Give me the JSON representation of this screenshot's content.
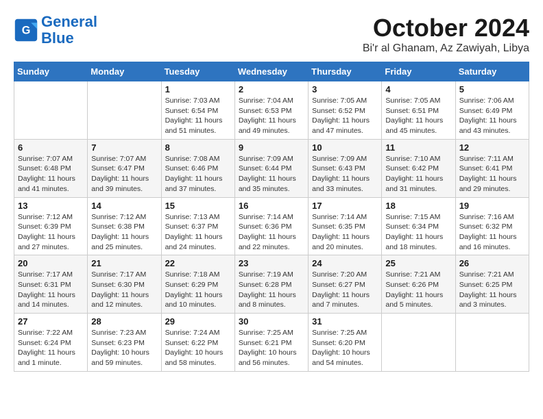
{
  "logo": {
    "line1": "General",
    "line2": "Blue"
  },
  "title": "October 2024",
  "location": "Bi'r al Ghanam, Az Zawiyah, Libya",
  "days_of_week": [
    "Sunday",
    "Monday",
    "Tuesday",
    "Wednesday",
    "Thursday",
    "Friday",
    "Saturday"
  ],
  "weeks": [
    [
      {
        "day": "",
        "detail": ""
      },
      {
        "day": "",
        "detail": ""
      },
      {
        "day": "1",
        "detail": "Sunrise: 7:03 AM\nSunset: 6:54 PM\nDaylight: 11 hours and 51 minutes."
      },
      {
        "day": "2",
        "detail": "Sunrise: 7:04 AM\nSunset: 6:53 PM\nDaylight: 11 hours and 49 minutes."
      },
      {
        "day": "3",
        "detail": "Sunrise: 7:05 AM\nSunset: 6:52 PM\nDaylight: 11 hours and 47 minutes."
      },
      {
        "day": "4",
        "detail": "Sunrise: 7:05 AM\nSunset: 6:51 PM\nDaylight: 11 hours and 45 minutes."
      },
      {
        "day": "5",
        "detail": "Sunrise: 7:06 AM\nSunset: 6:49 PM\nDaylight: 11 hours and 43 minutes."
      }
    ],
    [
      {
        "day": "6",
        "detail": "Sunrise: 7:07 AM\nSunset: 6:48 PM\nDaylight: 11 hours and 41 minutes."
      },
      {
        "day": "7",
        "detail": "Sunrise: 7:07 AM\nSunset: 6:47 PM\nDaylight: 11 hours and 39 minutes."
      },
      {
        "day": "8",
        "detail": "Sunrise: 7:08 AM\nSunset: 6:46 PM\nDaylight: 11 hours and 37 minutes."
      },
      {
        "day": "9",
        "detail": "Sunrise: 7:09 AM\nSunset: 6:44 PM\nDaylight: 11 hours and 35 minutes."
      },
      {
        "day": "10",
        "detail": "Sunrise: 7:09 AM\nSunset: 6:43 PM\nDaylight: 11 hours and 33 minutes."
      },
      {
        "day": "11",
        "detail": "Sunrise: 7:10 AM\nSunset: 6:42 PM\nDaylight: 11 hours and 31 minutes."
      },
      {
        "day": "12",
        "detail": "Sunrise: 7:11 AM\nSunset: 6:41 PM\nDaylight: 11 hours and 29 minutes."
      }
    ],
    [
      {
        "day": "13",
        "detail": "Sunrise: 7:12 AM\nSunset: 6:39 PM\nDaylight: 11 hours and 27 minutes."
      },
      {
        "day": "14",
        "detail": "Sunrise: 7:12 AM\nSunset: 6:38 PM\nDaylight: 11 hours and 25 minutes."
      },
      {
        "day": "15",
        "detail": "Sunrise: 7:13 AM\nSunset: 6:37 PM\nDaylight: 11 hours and 24 minutes."
      },
      {
        "day": "16",
        "detail": "Sunrise: 7:14 AM\nSunset: 6:36 PM\nDaylight: 11 hours and 22 minutes."
      },
      {
        "day": "17",
        "detail": "Sunrise: 7:14 AM\nSunset: 6:35 PM\nDaylight: 11 hours and 20 minutes."
      },
      {
        "day": "18",
        "detail": "Sunrise: 7:15 AM\nSunset: 6:34 PM\nDaylight: 11 hours and 18 minutes."
      },
      {
        "day": "19",
        "detail": "Sunrise: 7:16 AM\nSunset: 6:32 PM\nDaylight: 11 hours and 16 minutes."
      }
    ],
    [
      {
        "day": "20",
        "detail": "Sunrise: 7:17 AM\nSunset: 6:31 PM\nDaylight: 11 hours and 14 minutes."
      },
      {
        "day": "21",
        "detail": "Sunrise: 7:17 AM\nSunset: 6:30 PM\nDaylight: 11 hours and 12 minutes."
      },
      {
        "day": "22",
        "detail": "Sunrise: 7:18 AM\nSunset: 6:29 PM\nDaylight: 11 hours and 10 minutes."
      },
      {
        "day": "23",
        "detail": "Sunrise: 7:19 AM\nSunset: 6:28 PM\nDaylight: 11 hours and 8 minutes."
      },
      {
        "day": "24",
        "detail": "Sunrise: 7:20 AM\nSunset: 6:27 PM\nDaylight: 11 hours and 7 minutes."
      },
      {
        "day": "25",
        "detail": "Sunrise: 7:21 AM\nSunset: 6:26 PM\nDaylight: 11 hours and 5 minutes."
      },
      {
        "day": "26",
        "detail": "Sunrise: 7:21 AM\nSunset: 6:25 PM\nDaylight: 11 hours and 3 minutes."
      }
    ],
    [
      {
        "day": "27",
        "detail": "Sunrise: 7:22 AM\nSunset: 6:24 PM\nDaylight: 11 hours and 1 minute."
      },
      {
        "day": "28",
        "detail": "Sunrise: 7:23 AM\nSunset: 6:23 PM\nDaylight: 10 hours and 59 minutes."
      },
      {
        "day": "29",
        "detail": "Sunrise: 7:24 AM\nSunset: 6:22 PM\nDaylight: 10 hours and 58 minutes."
      },
      {
        "day": "30",
        "detail": "Sunrise: 7:25 AM\nSunset: 6:21 PM\nDaylight: 10 hours and 56 minutes."
      },
      {
        "day": "31",
        "detail": "Sunrise: 7:25 AM\nSunset: 6:20 PM\nDaylight: 10 hours and 54 minutes."
      },
      {
        "day": "",
        "detail": ""
      },
      {
        "day": "",
        "detail": ""
      }
    ]
  ]
}
